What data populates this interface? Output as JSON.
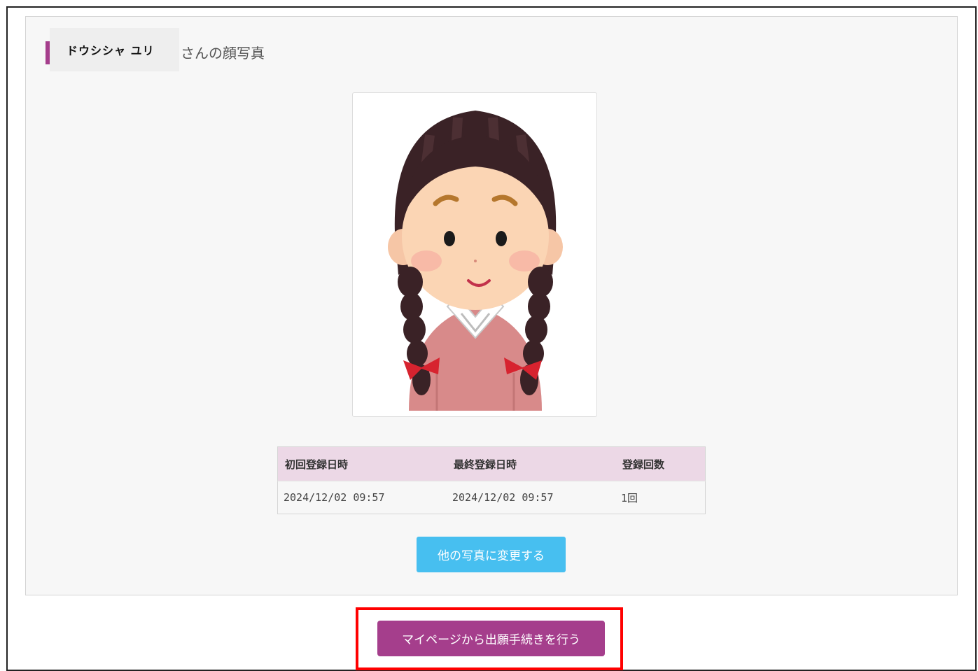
{
  "heading": {
    "name": "ドウシシャ ユリ",
    "suffix": "さんの顔写真"
  },
  "photo": {
    "icon": "girl-portrait-icon"
  },
  "registration_table": {
    "headers": [
      "初回登録日時",
      "最終登録日時",
      "登録回数"
    ],
    "rows": [
      [
        "2024/12/02 09:57",
        "2024/12/02 09:57",
        "1回"
      ]
    ]
  },
  "buttons": {
    "change_photo": "他の写真に変更する",
    "apply_from_mypage": "マイページから出願手続きを行う"
  },
  "colors": {
    "accent": "#a53e8c",
    "secondary_button": "#47bff0",
    "table_header": "#ecd8e6",
    "highlight": "#ff0000"
  }
}
